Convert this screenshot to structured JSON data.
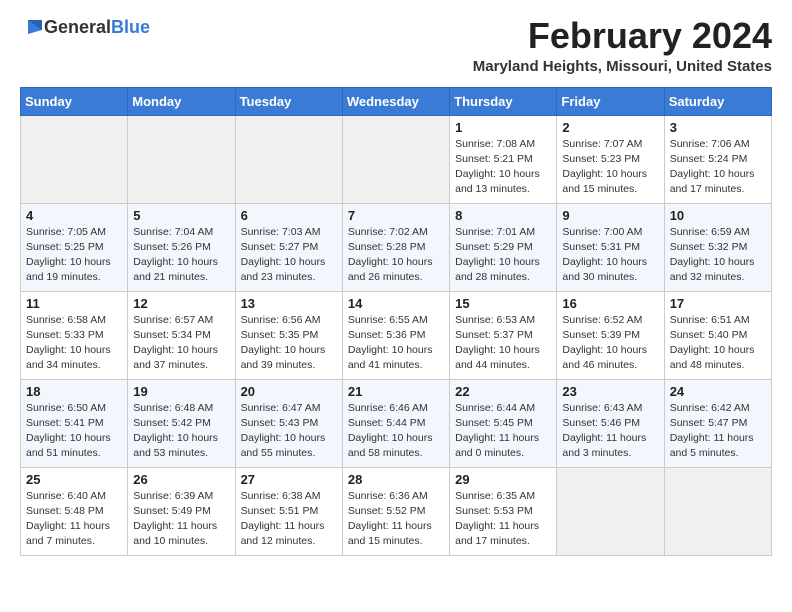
{
  "logo": {
    "text_general": "General",
    "text_blue": "Blue"
  },
  "title": {
    "month_year": "February 2024",
    "location": "Maryland Heights, Missouri, United States"
  },
  "days_of_week": [
    "Sunday",
    "Monday",
    "Tuesday",
    "Wednesday",
    "Thursday",
    "Friday",
    "Saturday"
  ],
  "weeks": [
    [
      {
        "day": "",
        "info": ""
      },
      {
        "day": "",
        "info": ""
      },
      {
        "day": "",
        "info": ""
      },
      {
        "day": "",
        "info": ""
      },
      {
        "day": "1",
        "info": "Sunrise: 7:08 AM\nSunset: 5:21 PM\nDaylight: 10 hours\nand 13 minutes."
      },
      {
        "day": "2",
        "info": "Sunrise: 7:07 AM\nSunset: 5:23 PM\nDaylight: 10 hours\nand 15 minutes."
      },
      {
        "day": "3",
        "info": "Sunrise: 7:06 AM\nSunset: 5:24 PM\nDaylight: 10 hours\nand 17 minutes."
      }
    ],
    [
      {
        "day": "4",
        "info": "Sunrise: 7:05 AM\nSunset: 5:25 PM\nDaylight: 10 hours\nand 19 minutes."
      },
      {
        "day": "5",
        "info": "Sunrise: 7:04 AM\nSunset: 5:26 PM\nDaylight: 10 hours\nand 21 minutes."
      },
      {
        "day": "6",
        "info": "Sunrise: 7:03 AM\nSunset: 5:27 PM\nDaylight: 10 hours\nand 23 minutes."
      },
      {
        "day": "7",
        "info": "Sunrise: 7:02 AM\nSunset: 5:28 PM\nDaylight: 10 hours\nand 26 minutes."
      },
      {
        "day": "8",
        "info": "Sunrise: 7:01 AM\nSunset: 5:29 PM\nDaylight: 10 hours\nand 28 minutes."
      },
      {
        "day": "9",
        "info": "Sunrise: 7:00 AM\nSunset: 5:31 PM\nDaylight: 10 hours\nand 30 minutes."
      },
      {
        "day": "10",
        "info": "Sunrise: 6:59 AM\nSunset: 5:32 PM\nDaylight: 10 hours\nand 32 minutes."
      }
    ],
    [
      {
        "day": "11",
        "info": "Sunrise: 6:58 AM\nSunset: 5:33 PM\nDaylight: 10 hours\nand 34 minutes."
      },
      {
        "day": "12",
        "info": "Sunrise: 6:57 AM\nSunset: 5:34 PM\nDaylight: 10 hours\nand 37 minutes."
      },
      {
        "day": "13",
        "info": "Sunrise: 6:56 AM\nSunset: 5:35 PM\nDaylight: 10 hours\nand 39 minutes."
      },
      {
        "day": "14",
        "info": "Sunrise: 6:55 AM\nSunset: 5:36 PM\nDaylight: 10 hours\nand 41 minutes."
      },
      {
        "day": "15",
        "info": "Sunrise: 6:53 AM\nSunset: 5:37 PM\nDaylight: 10 hours\nand 44 minutes."
      },
      {
        "day": "16",
        "info": "Sunrise: 6:52 AM\nSunset: 5:39 PM\nDaylight: 10 hours\nand 46 minutes."
      },
      {
        "day": "17",
        "info": "Sunrise: 6:51 AM\nSunset: 5:40 PM\nDaylight: 10 hours\nand 48 minutes."
      }
    ],
    [
      {
        "day": "18",
        "info": "Sunrise: 6:50 AM\nSunset: 5:41 PM\nDaylight: 10 hours\nand 51 minutes."
      },
      {
        "day": "19",
        "info": "Sunrise: 6:48 AM\nSunset: 5:42 PM\nDaylight: 10 hours\nand 53 minutes."
      },
      {
        "day": "20",
        "info": "Sunrise: 6:47 AM\nSunset: 5:43 PM\nDaylight: 10 hours\nand 55 minutes."
      },
      {
        "day": "21",
        "info": "Sunrise: 6:46 AM\nSunset: 5:44 PM\nDaylight: 10 hours\nand 58 minutes."
      },
      {
        "day": "22",
        "info": "Sunrise: 6:44 AM\nSunset: 5:45 PM\nDaylight: 11 hours\nand 0 minutes."
      },
      {
        "day": "23",
        "info": "Sunrise: 6:43 AM\nSunset: 5:46 PM\nDaylight: 11 hours\nand 3 minutes."
      },
      {
        "day": "24",
        "info": "Sunrise: 6:42 AM\nSunset: 5:47 PM\nDaylight: 11 hours\nand 5 minutes."
      }
    ],
    [
      {
        "day": "25",
        "info": "Sunrise: 6:40 AM\nSunset: 5:48 PM\nDaylight: 11 hours\nand 7 minutes."
      },
      {
        "day": "26",
        "info": "Sunrise: 6:39 AM\nSunset: 5:49 PM\nDaylight: 11 hours\nand 10 minutes."
      },
      {
        "day": "27",
        "info": "Sunrise: 6:38 AM\nSunset: 5:51 PM\nDaylight: 11 hours\nand 12 minutes."
      },
      {
        "day": "28",
        "info": "Sunrise: 6:36 AM\nSunset: 5:52 PM\nDaylight: 11 hours\nand 15 minutes."
      },
      {
        "day": "29",
        "info": "Sunrise: 6:35 AM\nSunset: 5:53 PM\nDaylight: 11 hours\nand 17 minutes."
      },
      {
        "day": "",
        "info": ""
      },
      {
        "day": "",
        "info": ""
      }
    ]
  ]
}
